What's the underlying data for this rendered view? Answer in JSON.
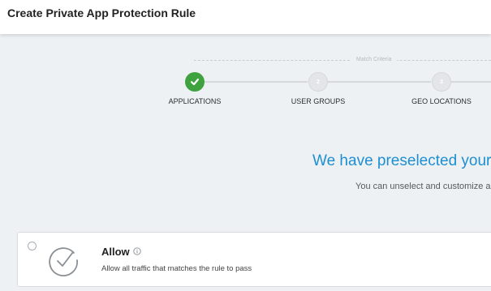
{
  "header": {
    "title": "Create Private App Protection Rule"
  },
  "wizard": {
    "criteria_label": "Match Criteria",
    "steps": [
      {
        "label": "APPLICATIONS",
        "status": "completed",
        "icon": "check-icon"
      },
      {
        "label": "USER GROUPS",
        "number": "2",
        "status": "pending"
      },
      {
        "label": "GEO LOCATIONS",
        "number": "3",
        "status": "pending"
      }
    ]
  },
  "main": {
    "headline": "We have preselected your",
    "subtext": "You can unselect and customize a"
  },
  "action_option": {
    "title": "Allow",
    "description": "Allow all traffic that matches the rule to pass",
    "icon": "checkmark-circle-icon",
    "info_icon": "info-icon",
    "selected": false
  },
  "colors": {
    "accent": "#1d8fd1",
    "success": "#3ea23e",
    "background": "#eef1f4"
  }
}
